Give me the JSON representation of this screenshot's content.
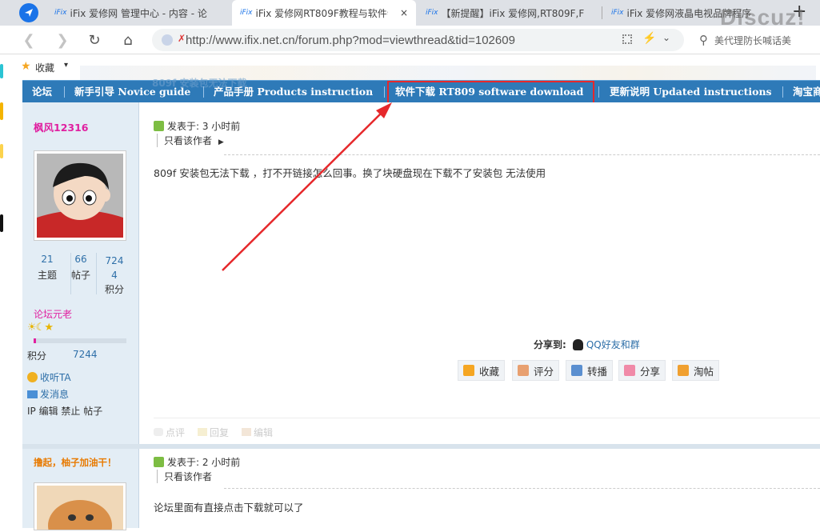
{
  "browser": {
    "tabs": [
      {
        "favicon": "iFix",
        "title": "iFix 爱修网 管理中心 - 内容 - 论"
      },
      {
        "favicon": "iFix",
        "title": "iFix 爱修网RT809F教程与软件会",
        "close": "×"
      },
      {
        "favicon": "iFix",
        "title": "【新提醒】iFix 爱修网,RT809F,F"
      },
      {
        "favicon": "iFix",
        "title": "iFix 爱修网液晶电视品牌程序"
      }
    ],
    "new_tab": "+",
    "url": "http://www.ifix.net.cn/forum.php?mod=viewthread&tid=102609",
    "search_text": "美代理防长喊话美",
    "bookmark_label": "收藏"
  },
  "watermark": "Discuz!",
  "forum_nav": {
    "items": [
      "论坛",
      "新手引导 Novice guide",
      "产品手册 Products instruction",
      "软件下载 RT809 software download",
      "更新说明 Updated instructions",
      "淘宝商"
    ],
    "ghost_title": "809f 安装包无法下载",
    "highlight_color": "#e6282b"
  },
  "post1": {
    "author": "枫风12316",
    "stats": [
      {
        "value": "21",
        "label": "主题"
      },
      {
        "value": "66",
        "label": "帖子"
      },
      {
        "value": "7244",
        "label": "积分"
      }
    ],
    "rank": "论坛元老",
    "points_label": "积分",
    "points_value": "7244",
    "links": [
      "收听TA",
      "发消息"
    ],
    "admin": "IP 编辑 禁止 帖子",
    "posted": "发表于: 3 小时前",
    "only_author": "只看该作者",
    "content": "809f 安装包无法下载 ，打不开链接怎么回事。换了块硬盘现在下载不了安装包 无法使用",
    "share_label": "分享到:",
    "share_target": "QQ好友和群",
    "actions": [
      "收藏",
      "评分",
      "转播",
      "分享",
      "淘帖"
    ],
    "footer": [
      "点评",
      "回复",
      "编辑"
    ]
  },
  "post2": {
    "author": "撸起，柚子加油干！",
    "posted": "发表于: 2 小时前",
    "only_author": "只看该作者",
    "content": "论坛里面有直接点击下载就可以了"
  }
}
